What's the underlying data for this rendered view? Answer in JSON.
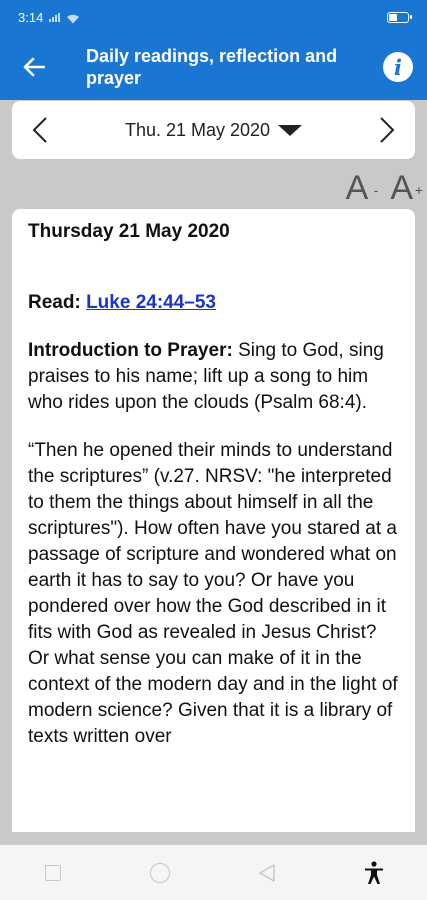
{
  "status": {
    "time": "3:14"
  },
  "appbar": {
    "title": "Daily readings, reflection and prayer"
  },
  "date_nav": {
    "date": "Thu. 21 May 2020"
  },
  "font_controls": {
    "decrease": "A",
    "decrease_sup": "-",
    "increase": "A",
    "increase_sup": "+"
  },
  "content": {
    "heading": "Thursday 21 May 2020",
    "read_label": "Read:",
    "read_link": "Luke 24:44–53",
    "intro_label": "Introduction to Prayer:",
    "intro_text": "Sing to God, sing praises to his name; lift up a song to him who rides upon the clouds (Psalm 68:4).",
    "body": "“Then he opened their minds to understand the scriptures” (v.27. NRSV: \"he interpreted to them the things about himself in all the scriptures\"). How often have you stared at a passage of scripture and wondered what on earth it has to say to you? Or have you pondered over how the God described in it fits with God as revealed in Jesus Christ? Or what sense you can make of it in the context of the modern day and in the light of modern science? Given that it is a library of texts written over"
  },
  "colors": {
    "primary": "#1976d2",
    "link": "#1a33c9",
    "background": "#c9c9c9"
  }
}
